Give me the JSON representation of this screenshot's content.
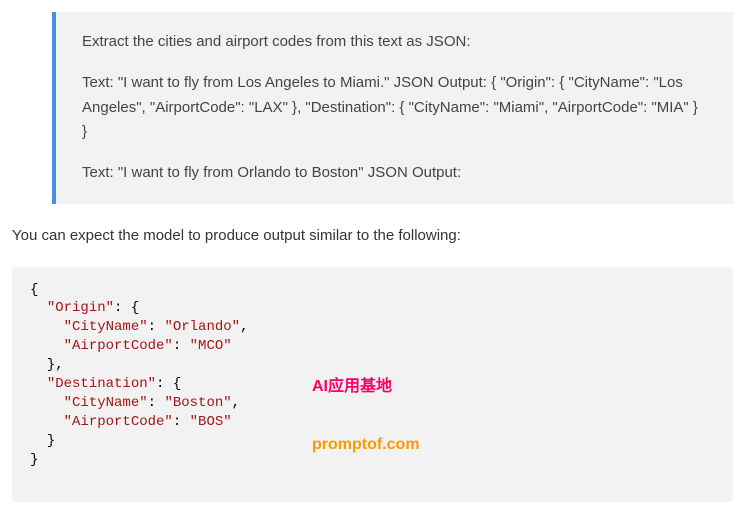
{
  "quote": {
    "title": "Extract the cities and airport codes from this text as JSON:",
    "body": "Text: \"I want to fly from Los Angeles to Miami.\" JSON Output: { \"Origin\": { \"CityName\": \"Los Angeles\", \"AirportCode\": \"LAX\" }, \"Destination\": { \"CityName\": \"Miami\", \"AirportCode\": \"MIA\" } }",
    "footer": "Text: \"I want to fly from Orlando to Boston\" JSON Output:"
  },
  "lead": "You can expect the model to produce output similar to the following:",
  "code": {
    "l1": "{",
    "l2a": "  ",
    "l2k": "\"Origin\"",
    "l2b": ": {",
    "l3a": "    ",
    "l3k": "\"CityName\"",
    "l3b": ": ",
    "l3v": "\"Orlando\"",
    "l3c": ",",
    "l4a": "    ",
    "l4k": "\"AirportCode\"",
    "l4b": ": ",
    "l4v": "\"MCO\"",
    "l5": "  },",
    "l6a": "  ",
    "l6k": "\"Destination\"",
    "l6b": ": {",
    "l7a": "    ",
    "l7k": "\"CityName\"",
    "l7b": ": ",
    "l7v": "\"Boston\"",
    "l7c": ",",
    "l8a": "    ",
    "l8k": "\"AirportCode\"",
    "l8b": ": ",
    "l8v": "\"BOS\"",
    "l9": "  }",
    "l10": "}"
  },
  "watermark": {
    "top": "AI应用基地",
    "bottom": "promptof.com"
  }
}
